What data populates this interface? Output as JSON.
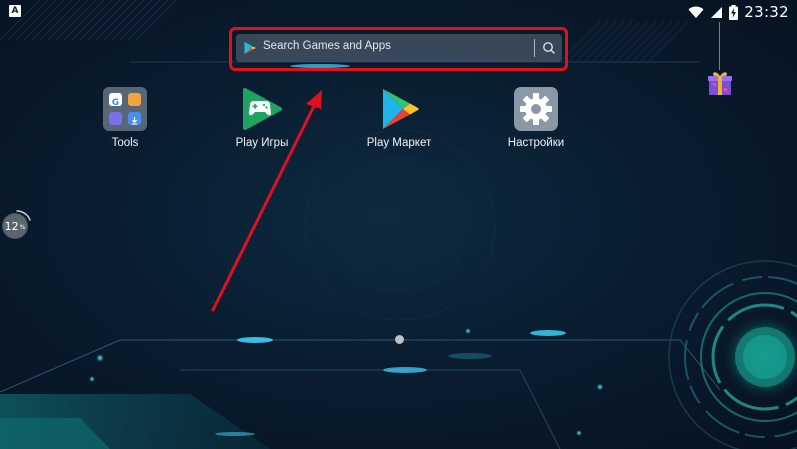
{
  "status_bar": {
    "notification_letter": "A",
    "time": "23:32",
    "icons": [
      "wifi-icon",
      "signal-icon",
      "battery-charging-icon"
    ]
  },
  "search": {
    "placeholder": "Search Games and Apps",
    "left_icon": "play-store-icon",
    "right_icon": "search-icon"
  },
  "apps": [
    {
      "label": "Tools",
      "icon": "tools-folder-icon"
    },
    {
      "label": "Play Игры",
      "icon": "play-games-icon"
    },
    {
      "label": "Play Маркет",
      "icon": "play-market-icon"
    },
    {
      "label": "Настройки",
      "icon": "settings-icon"
    }
  ],
  "side_badge": {
    "value": "12",
    "unit": "%"
  },
  "gift": {
    "icon": "gift-icon"
  },
  "pager": {
    "pages": 1,
    "current": 1
  },
  "colors": {
    "highlight": "#e0101e",
    "background": "#0a1d30",
    "accent_teal": "#1ec8b4"
  }
}
